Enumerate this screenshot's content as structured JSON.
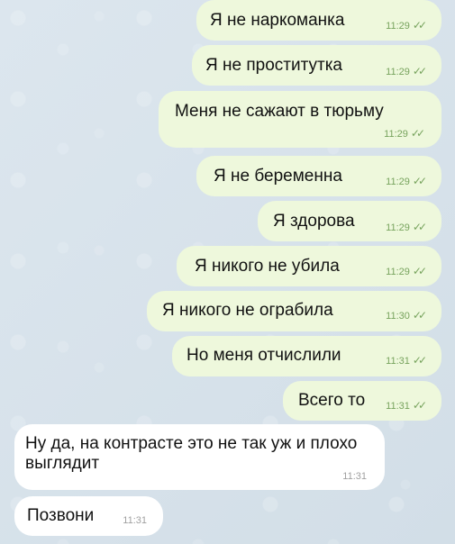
{
  "chat": {
    "messages": [
      {
        "text": "Я не наркоманка",
        "time": "11:29",
        "status": "✓✓"
      },
      {
        "text": "Я не проститутка",
        "time": "11:29",
        "status": "✓✓"
      },
      {
        "text": "Меня не сажают в тюрьму",
        "time": "11:29",
        "status": "✓✓"
      },
      {
        "text": "Я не беременна",
        "time": "11:29",
        "status": "✓✓"
      },
      {
        "text": "Я здорова",
        "time": "11:29",
        "status": "✓✓"
      },
      {
        "text": "Я никого не убила",
        "time": "11:29",
        "status": "✓✓"
      },
      {
        "text": "Я никого не ограбила",
        "time": "11:30",
        "status": "✓✓"
      },
      {
        "text": "Но меня отчислили",
        "time": "11:31",
        "status": "✓✓"
      },
      {
        "text": "Всего то",
        "time": "11:31",
        "status": "✓✓"
      },
      {
        "text": "Ну да, на контрасте это не так уж и плохо выглядит",
        "time": "11:31"
      },
      {
        "text": "Позвони",
        "time": "11:31"
      }
    ]
  },
  "colors": {
    "outgoing_bubble": "#eef8dc",
    "incoming_bubble": "#ffffff",
    "background": "#d7e2ea",
    "outgoing_meta": "#77a35d",
    "incoming_meta": "#a0a0a0"
  },
  "icons": {
    "read_receipt": "double-check-icon"
  }
}
